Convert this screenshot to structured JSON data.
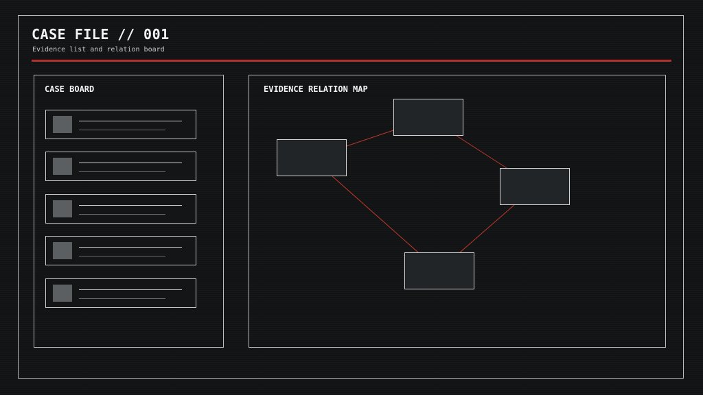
{
  "header": {
    "title": "CASE FILE // 001",
    "subtitle": "Evidence list and relation board"
  },
  "case_board": {
    "title": "CASE BOARD",
    "items_count_note": "",
    "items": [
      {},
      {},
      {},
      {},
      {}
    ]
  },
  "relation_map": {
    "title": "EVIDENCE RELATION MAP",
    "nodes": [
      "node-a",
      "node-b",
      "node-c",
      "node-d"
    ],
    "links": [
      [
        "node-a",
        "node-b"
      ],
      [
        "node-b",
        "node-c"
      ],
      [
        "node-a",
        "node-d"
      ],
      [
        "node-c",
        "node-d"
      ]
    ]
  },
  "colors": {
    "background": "#121314",
    "accent_red": "#b23131",
    "link_red": "#c0392b",
    "border": "#bdbdbd"
  }
}
